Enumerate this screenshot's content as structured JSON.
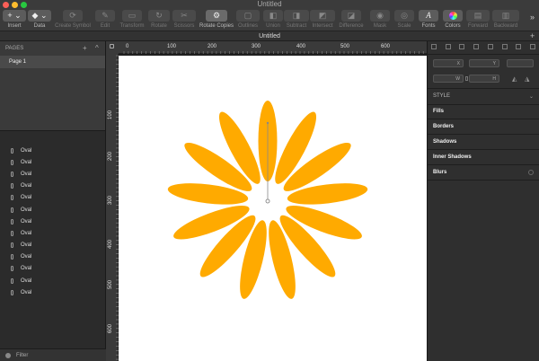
{
  "window": {
    "title": "Untitled",
    "doc_tab": "Untitled"
  },
  "toolbar": {
    "items": [
      {
        "label": "Insert",
        "glyph": "+ ⌄"
      },
      {
        "label": "Data",
        "glyph": "◆ ⌄"
      },
      {
        "label": "Create Symbol",
        "glyph": "⟳"
      },
      {
        "label": "Edit",
        "glyph": "✎"
      },
      {
        "label": "Transform",
        "glyph": "▭"
      },
      {
        "label": "Rotate",
        "glyph": "↻"
      },
      {
        "label": "Scissors",
        "glyph": "✂"
      },
      {
        "label": "Rotate Copies",
        "glyph": "⚙"
      },
      {
        "label": "Outlines",
        "glyph": "▢"
      },
      {
        "label": "Union",
        "glyph": "◧"
      },
      {
        "label": "Subtract",
        "glyph": "◨"
      },
      {
        "label": "Intersect",
        "glyph": "◩"
      },
      {
        "label": "Difference",
        "glyph": "◪"
      },
      {
        "label": "Mask",
        "glyph": "◉"
      },
      {
        "label": "Scale",
        "glyph": "◎"
      },
      {
        "label": "Fonts",
        "glyph": "A"
      },
      {
        "label": "Colors",
        "glyph": "◕"
      },
      {
        "label": "Forward",
        "glyph": "▤"
      },
      {
        "label": "Backward",
        "glyph": "▥"
      }
    ],
    "overflow": "»"
  },
  "left_panel": {
    "pages_header": "PAGES",
    "add_icon": "+",
    "collapse_icon": "^",
    "pages": [
      "Page 1"
    ],
    "layers": [
      "Oval",
      "Oval",
      "Oval",
      "Oval",
      "Oval",
      "Oval",
      "Oval",
      "Oval",
      "Oval",
      "Oval",
      "Oval",
      "Oval",
      "Oval"
    ],
    "filter_label": "Filter"
  },
  "rulers": {
    "h_ticks": [
      "0",
      "100",
      "200",
      "300",
      "400",
      "500",
      "600"
    ],
    "v_ticks": [
      "100",
      "200",
      "300",
      "400",
      "500",
      "600"
    ]
  },
  "right_panel": {
    "fields": {
      "x": "X",
      "y": "Y",
      "w": "W",
      "h": "H"
    },
    "style_header": "STYLE",
    "sections": [
      "Fills",
      "Borders",
      "Shadows",
      "Inner Shadows",
      "Blurs"
    ]
  },
  "colors": {
    "petal": "#FFAA00",
    "rotation_handle": "#888888"
  }
}
